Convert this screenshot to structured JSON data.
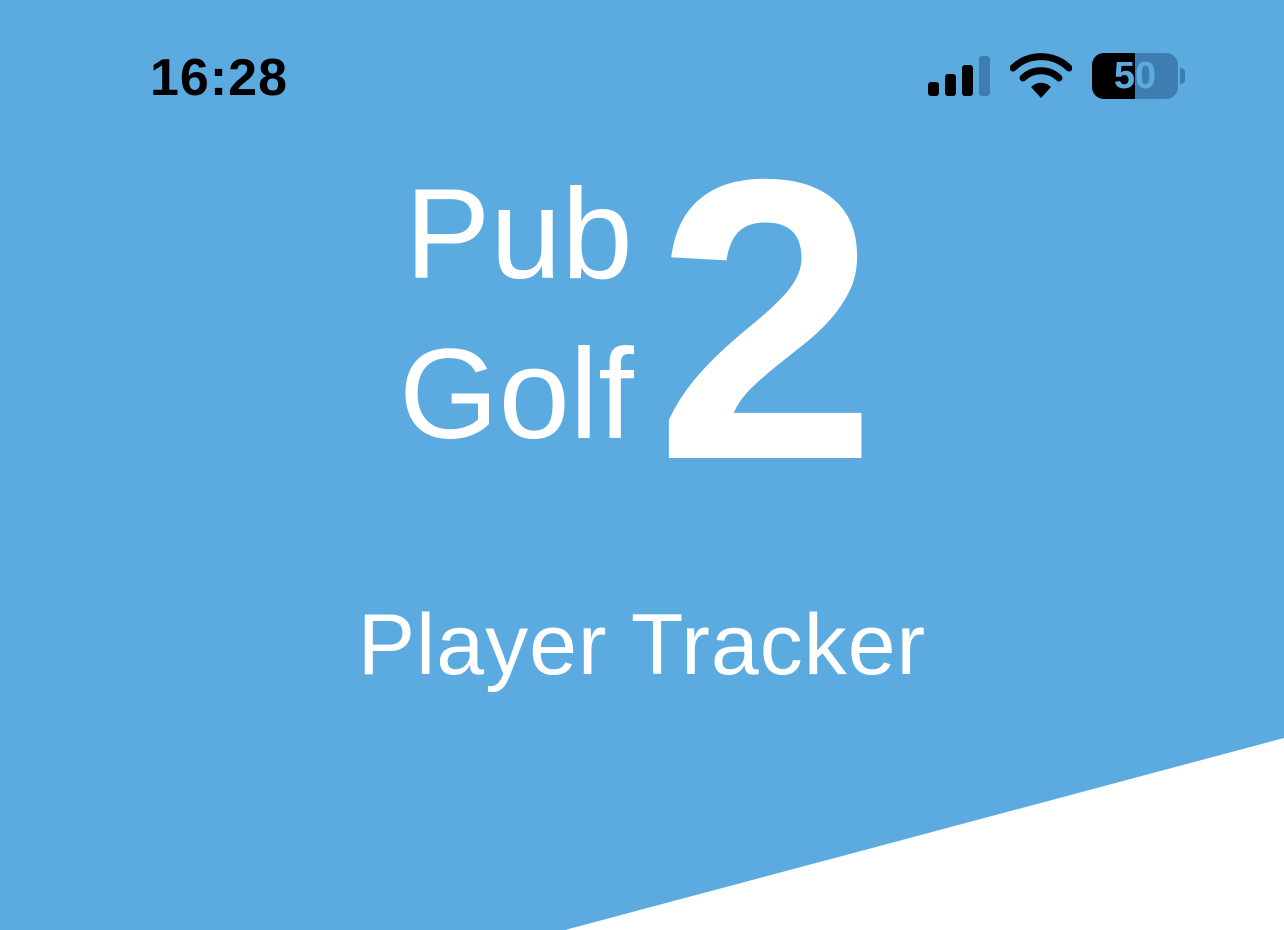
{
  "status_bar": {
    "time": "16:28",
    "battery_level": "50",
    "signal_icon": "cellular-signal-icon",
    "wifi_icon": "wifi-icon",
    "battery_icon": "battery-icon"
  },
  "app": {
    "logo_word_1": "Pub",
    "logo_word_2": "Golf",
    "logo_number": "2",
    "subtitle": "Player Tracker"
  },
  "colors": {
    "background": "#5baae0",
    "wedge": "#ffffff",
    "text": "#ffffff",
    "status_text": "#000000"
  }
}
